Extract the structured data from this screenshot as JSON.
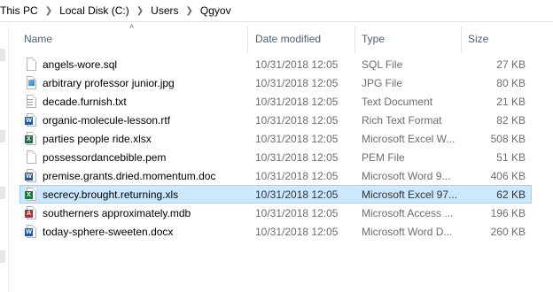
{
  "breadcrumb": [
    "This PC",
    "Local Disk (C:)",
    "Users",
    "Qgyov"
  ],
  "columns": {
    "name": "Name",
    "date": "Date modified",
    "type": "Type",
    "size": "Size"
  },
  "files": [
    {
      "name": "angels-wore.sql",
      "date": "10/31/2018 12:05",
      "type": "SQL File",
      "size": "27 KB",
      "icon": "blank-file-icon"
    },
    {
      "name": "arbitrary professor junior.jpg",
      "date": "10/31/2018 12:05",
      "type": "JPG File",
      "size": "80 KB",
      "icon": "image-file-icon"
    },
    {
      "name": "decade.furnish.txt",
      "date": "10/31/2018 12:05",
      "type": "Text Document",
      "size": "21 KB",
      "icon": "text-file-icon"
    },
    {
      "name": "organic-molecule-lesson.rtf",
      "date": "10/31/2018 12:05",
      "type": "Rich Text Format",
      "size": "82 KB",
      "icon": "word-file-icon"
    },
    {
      "name": "parties people ride.xlsx",
      "date": "10/31/2018 12:05",
      "type": "Microsoft Excel W...",
      "size": "508 KB",
      "icon": "excel-file-icon"
    },
    {
      "name": "possessordancebible.pem",
      "date": "10/31/2018 12:05",
      "type": "PEM File",
      "size": "51 KB",
      "icon": "blank-file-icon"
    },
    {
      "name": "premise.grants.dried.momentum.doc",
      "date": "10/31/2018 12:05",
      "type": "Microsoft Word 9...",
      "size": "406 KB",
      "icon": "word-file-icon"
    },
    {
      "name": "secrecy.brought.returning.xls",
      "date": "10/31/2018 12:05",
      "type": "Microsoft Excel 97...",
      "size": "62 KB",
      "icon": "excel-file-icon",
      "selected": true
    },
    {
      "name": "southerners approximately.mdb",
      "date": "10/31/2018 12:05",
      "type": "Microsoft Access ...",
      "size": "196 KB",
      "icon": "access-file-icon"
    },
    {
      "name": "today-sphere-sweeten.docx",
      "date": "10/31/2018 12:05",
      "type": "Microsoft Word D...",
      "size": "260 KB",
      "icon": "word-file-icon"
    }
  ],
  "colors": {
    "selection": "#cce8ff",
    "selection_border": "#99d1ff",
    "header_text": "#4c607a",
    "word": "#2b579a",
    "excel": "#217346",
    "access": "#a4373a"
  }
}
